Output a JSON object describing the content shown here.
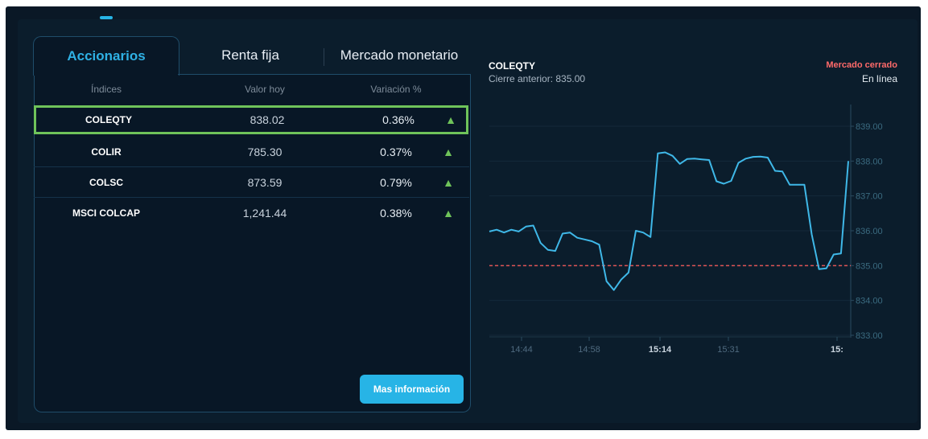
{
  "tabs": [
    {
      "label": "Accionarios",
      "active": true
    },
    {
      "label": "Renta fija",
      "active": false
    },
    {
      "label": "Mercado monetario",
      "active": false
    }
  ],
  "table": {
    "headers": [
      "Índices",
      "Valor hoy",
      "Variación %"
    ],
    "rows": [
      {
        "name": "COLEQTY",
        "value": "838.02",
        "variation": "0.36%",
        "trend": "up",
        "selected": true
      },
      {
        "name": "COLIR",
        "value": "785.30",
        "variation": "0.37%",
        "trend": "up",
        "selected": false
      },
      {
        "name": "COLSC",
        "value": "873.59",
        "variation": "0.79%",
        "trend": "up",
        "selected": false
      },
      {
        "name": "MSCI COLCAP",
        "value": "1,241.44",
        "variation": "0.38%",
        "trend": "up",
        "selected": false
      }
    ]
  },
  "more_button": "Mas información",
  "chart_header": {
    "title": "COLEQTY",
    "previous_close": "Cierre anterior: 835.00",
    "market_status": "Mercado cerrado",
    "connection": "En línea"
  },
  "colors": {
    "accent": "#27b4e6",
    "up": "#6fc35a",
    "line": "#3fb8e8",
    "reference": "#e05555",
    "closed": "#ff6a6a"
  },
  "chart_data": {
    "type": "line",
    "title": "COLEQTY",
    "reference_line": 835.0,
    "ylim": [
      833.0,
      839.5
    ],
    "yticks": [
      "839.00",
      "838.00",
      "837.00",
      "836.00",
      "835.00",
      "834.00",
      "833.00"
    ],
    "xticks": [
      {
        "label": "14:44",
        "bold": false
      },
      {
        "label": "14:58",
        "bold": false
      },
      {
        "label": "15:14",
        "bold": true
      },
      {
        "label": "15:31",
        "bold": false
      },
      {
        "label": "15:",
        "bold": true
      }
    ],
    "series": [
      {
        "values": [
          835.98,
          836.03,
          835.95,
          836.03,
          835.98,
          836.12,
          836.15,
          835.65,
          835.45,
          835.42,
          835.92,
          835.95,
          835.8,
          835.75,
          835.7,
          835.6,
          834.55,
          834.3,
          834.6,
          834.8,
          836.0,
          835.95,
          835.82,
          838.22,
          838.25,
          838.15,
          837.92,
          838.06,
          838.07,
          838.05,
          838.03,
          837.42,
          837.35,
          837.43,
          837.95,
          838.07,
          838.12,
          838.13,
          838.1,
          837.72,
          837.7,
          837.32,
          837.32,
          837.32,
          835.9,
          834.9,
          834.92,
          835.32,
          835.35,
          838.0
        ]
      }
    ]
  }
}
